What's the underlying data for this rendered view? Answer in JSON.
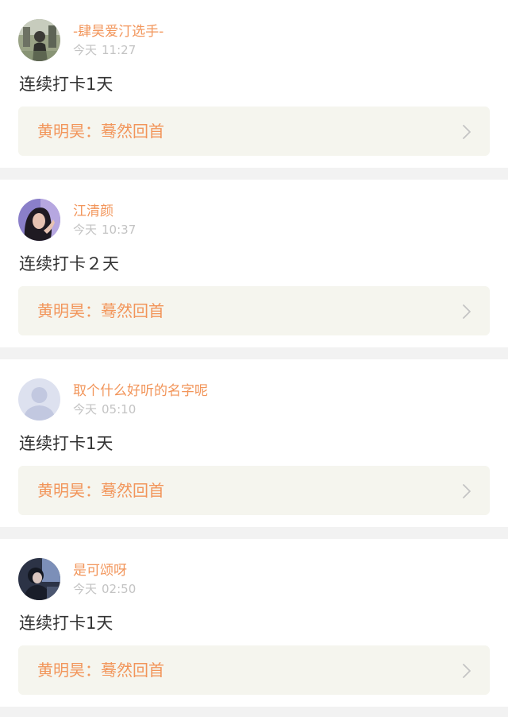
{
  "posts": [
    {
      "username": "-肆昊爱汀选手-",
      "date_label": "今天",
      "time": "11:27",
      "content": "连续打卡1天",
      "link_text": "黄明昊：蓦然回首",
      "avatar_icon": "photo-avatar-icon"
    },
    {
      "username": "江清颜",
      "date_label": "今天",
      "time": "10:37",
      "content": "连续打卡２天",
      "link_text": "黄明昊：蓦然回首",
      "avatar_icon": "photo-avatar-icon"
    },
    {
      "username": "取个什么好听的名字呢",
      "date_label": "今天",
      "time": "05:10",
      "content": "连续打卡1天",
      "link_text": "黄明昊：蓦然回首",
      "avatar_icon": "default-avatar-icon"
    },
    {
      "username": "是可颂呀",
      "date_label": "今天",
      "time": "02:50",
      "content": "连续打卡1天",
      "link_text": "黄明昊：蓦然回首",
      "avatar_icon": "photo-avatar-icon"
    }
  ],
  "colors": {
    "accent": "#f2955a",
    "text": "#333333",
    "muted": "#c3c3c3",
    "card_bg": "#f5f5ee",
    "page_bg": "#f2f2f2"
  }
}
